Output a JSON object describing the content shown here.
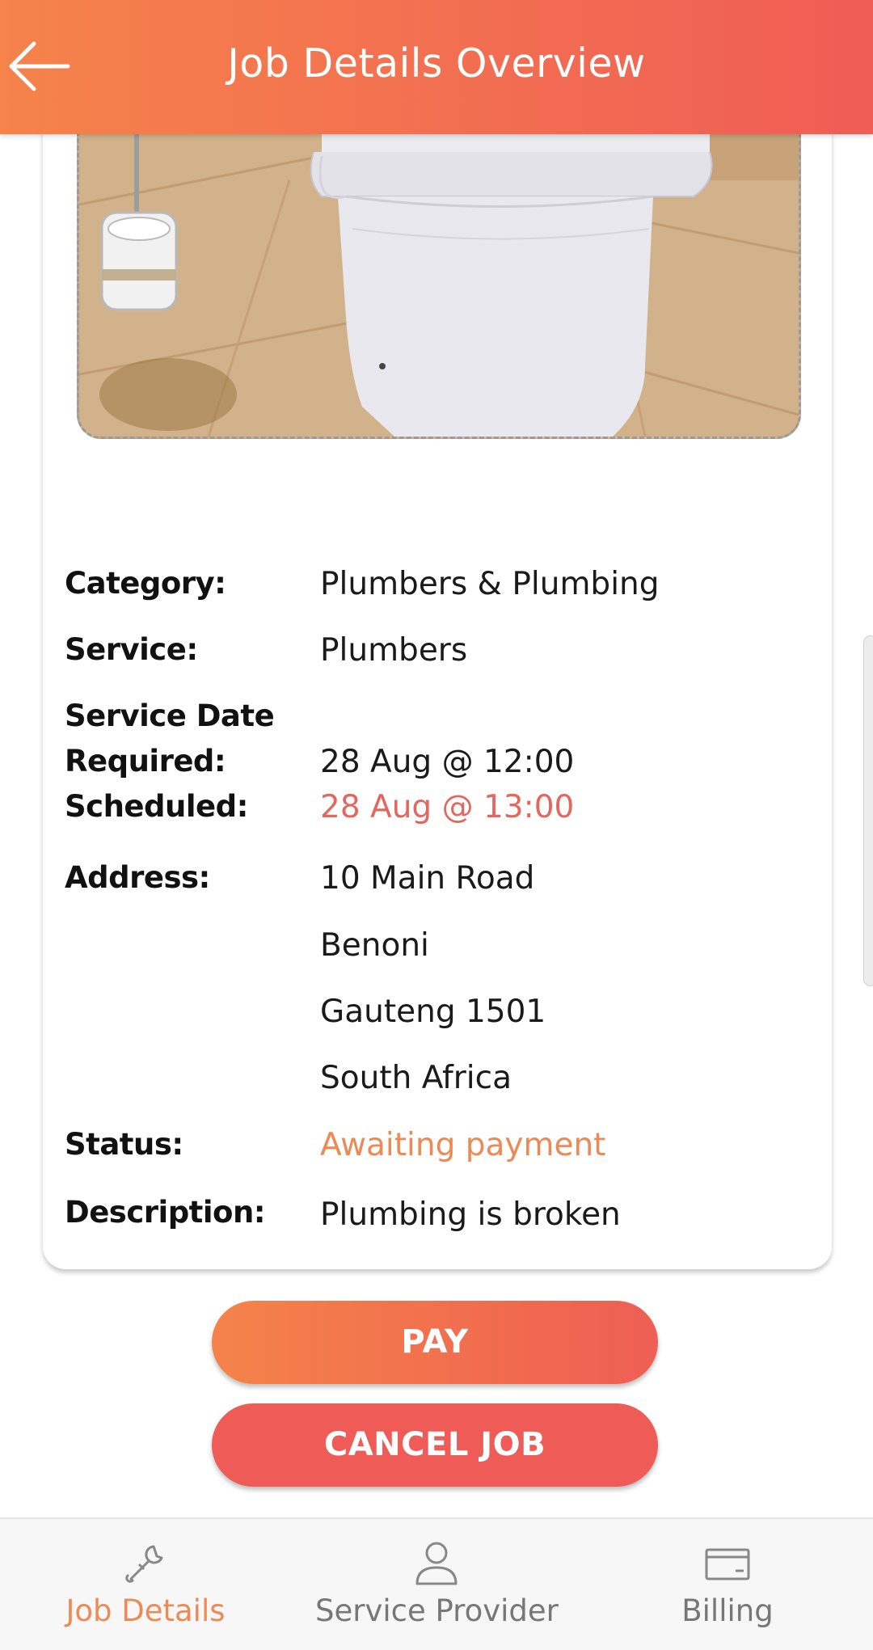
{
  "header": {
    "title": "Job Details Overview"
  },
  "details": {
    "category_label": "Category:",
    "category_value": "Plumbers & Plumbing",
    "service_label": "Service:",
    "service_value": "Plumbers",
    "service_date_label": "Service Date",
    "required_label": "Required:",
    "required_value": "28 Aug @ 12:00",
    "scheduled_label": "Scheduled:",
    "scheduled_value": "28 Aug @ 13:00",
    "address_label": "Address:",
    "address_lines": [
      "10 Main Road",
      "Benoni",
      "Gauteng 1501",
      "South Africa"
    ],
    "status_label": "Status:",
    "status_value": "Awaiting payment",
    "description_label": "Description:",
    "description_value": "Plumbing is broken"
  },
  "actions": {
    "pay_label": "PAY",
    "cancel_label": "CANCEL JOB"
  },
  "bottom_nav": {
    "items": [
      {
        "label": "Job Details",
        "icon": "wrench-icon",
        "active": true
      },
      {
        "label": "Service Provider",
        "icon": "person-icon",
        "active": false
      },
      {
        "label": "Billing",
        "icon": "credit-card-icon",
        "active": false
      }
    ]
  },
  "colors": {
    "accent_orange": "#f5834a",
    "accent_red": "#ef5b57",
    "scheduled_text": "#e2675f",
    "status_text": "#ec8a55",
    "nav_active": "#ee8a56"
  }
}
